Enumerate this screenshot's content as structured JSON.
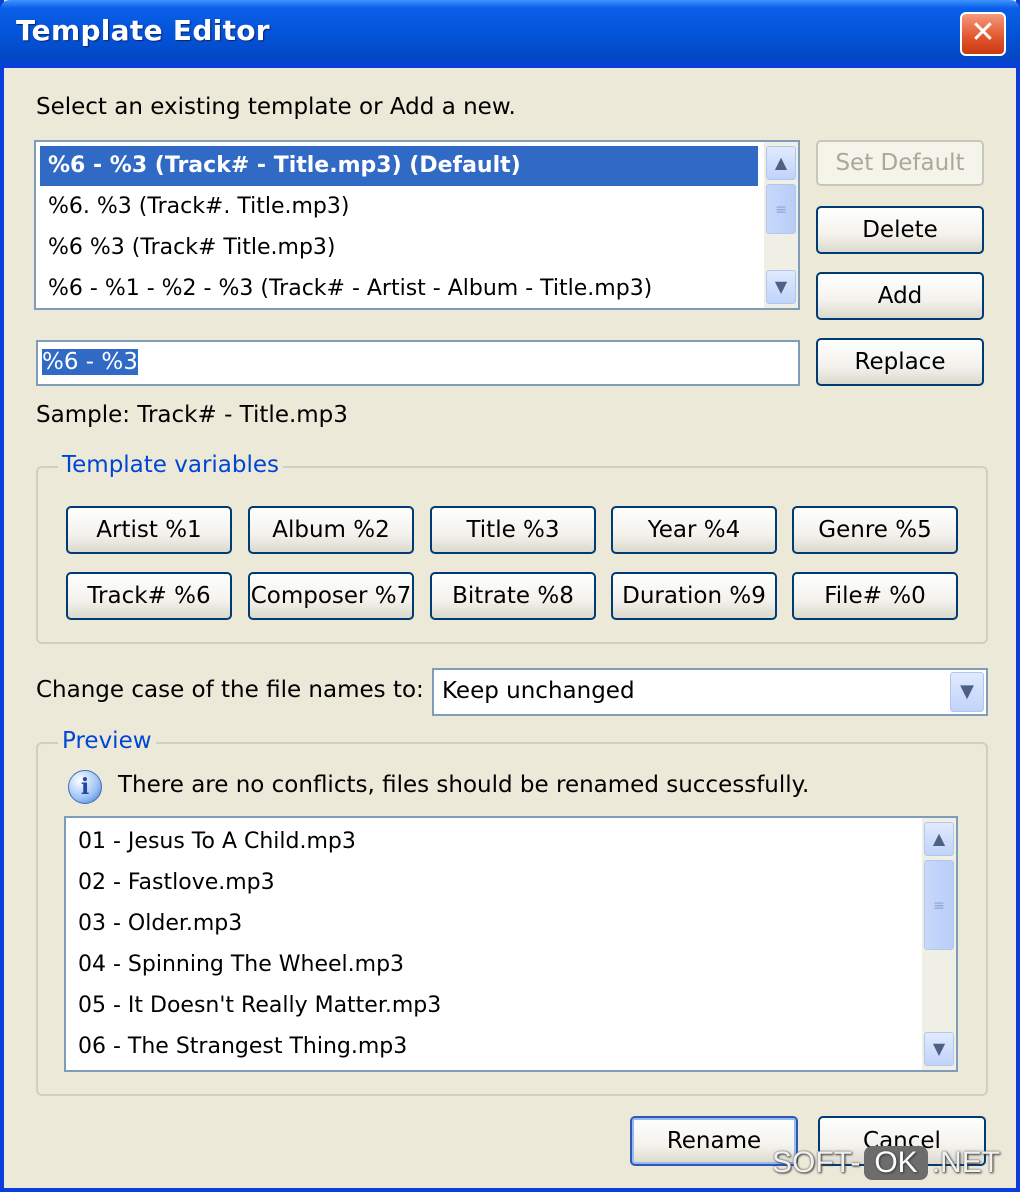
{
  "window": {
    "title": "Template Editor",
    "close_glyph": "✕"
  },
  "instructions": "Select an existing template or Add a new.",
  "templates": [
    "%6 - %3 (Track# - Title.mp3) (Default)",
    "%6. %3 (Track#. Title.mp3)",
    "%6 %3 (Track# Title.mp3)",
    "%6 - %1 - %2 - %3 (Track# - Artist - Album - Title.mp3)"
  ],
  "buttons": {
    "set_default": "Set Default",
    "delete": "Delete",
    "add": "Add",
    "replace": "Replace",
    "rename": "Rename",
    "cancel": "Cancel"
  },
  "template_field": {
    "value": "%6 - %3"
  },
  "sample": "Sample: Track# - Title.mp3",
  "variables": {
    "legend": "Template variables",
    "items": [
      "Artist %1",
      "Album %2",
      "Title %3",
      "Year %4",
      "Genre %5",
      "Track# %6",
      "Composer %7",
      "Bitrate %8",
      "Duration %9",
      "File# %0"
    ]
  },
  "case": {
    "label": "Change case of the file names to:",
    "selected": "Keep unchanged"
  },
  "preview": {
    "legend": "Preview",
    "message": "There are no conflicts, files should be renamed successfully.",
    "info_glyph": "i",
    "files": [
      "01 - Jesus To A Child.mp3",
      "02 - Fastlove.mp3",
      "03 - Older.mp3",
      "04 - Spinning The Wheel.mp3",
      "05 - It Doesn't Really Matter.mp3",
      "06 - The Strangest Thing.mp3"
    ]
  },
  "watermark": {
    "left": "SOFT-",
    "mid": "OK",
    "right": ".NET"
  },
  "icons": {
    "scroll_up": "scroll-up-arrow-icon",
    "scroll_down": "scroll-down-arrow-icon",
    "dropdown": "chevron-down-icon",
    "info": "info-icon",
    "close": "close-icon"
  }
}
